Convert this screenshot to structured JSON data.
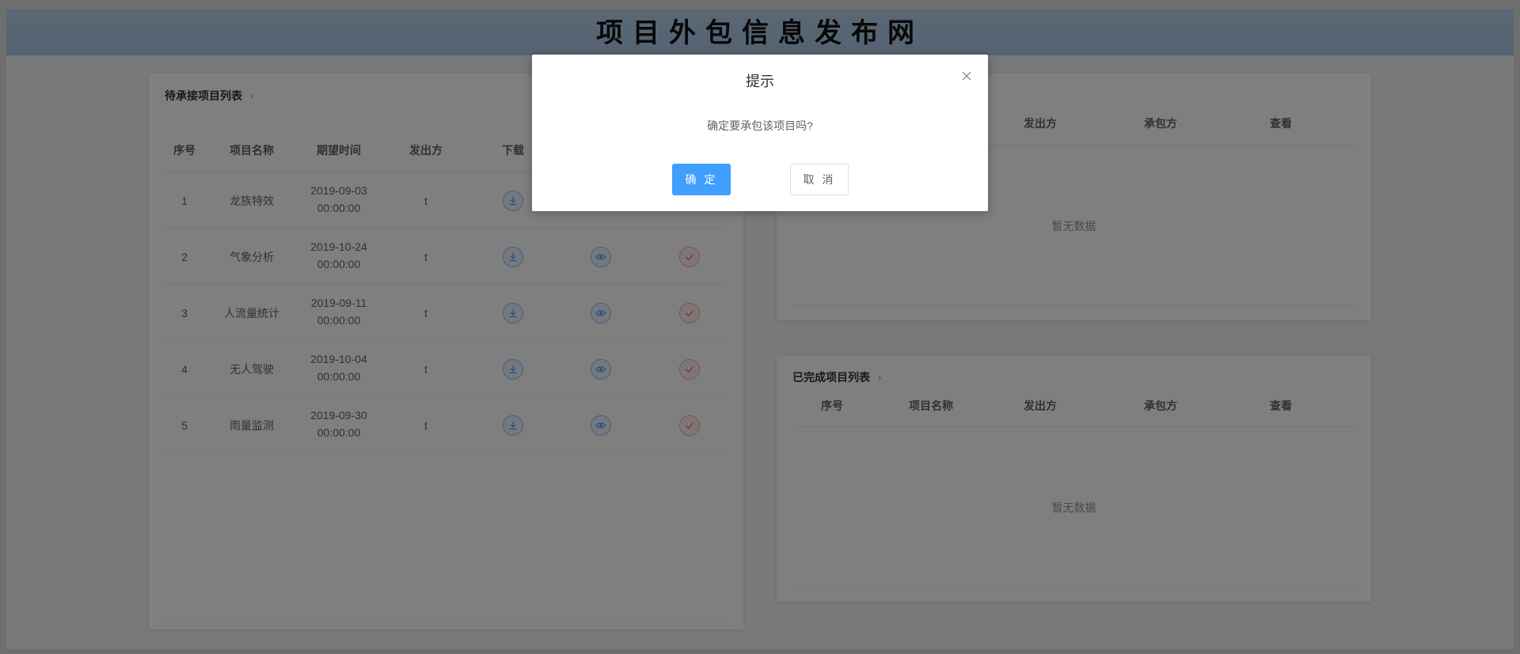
{
  "header": {
    "title": "项目外包信息发布网"
  },
  "pending": {
    "title": "待承接项目列表",
    "chevron": "›",
    "columns": [
      "序号",
      "项目名称",
      "期望时间",
      "发出方",
      "下载"
    ],
    "rows": [
      {
        "no": "1",
        "name": "龙族特效",
        "date": "2019-09-03",
        "time": "00:00:00",
        "from": "t"
      },
      {
        "no": "2",
        "name": "气象分析",
        "date": "2019-10-24",
        "time": "00:00:00",
        "from": "t"
      },
      {
        "no": "3",
        "name": "人流量统计",
        "date": "2019-09-11",
        "time": "00:00:00",
        "from": "t"
      },
      {
        "no": "4",
        "name": "无人驾驶",
        "date": "2019-10-04",
        "time": "00:00:00",
        "from": "t"
      },
      {
        "no": "5",
        "name": "雨量监测",
        "date": "2019-09-30",
        "time": "00:00:00",
        "from": "t"
      }
    ]
  },
  "in_progress": {
    "columns": [
      "发出方",
      "承包方",
      "查看"
    ],
    "empty_text": "暂无数据"
  },
  "completed": {
    "title": "已完成项目列表",
    "chevron": "›",
    "columns": [
      "序号",
      "项目名称",
      "发出方",
      "承包方",
      "查看"
    ],
    "empty_text": "暂无数据"
  },
  "dialog": {
    "title": "提示",
    "message": "确定要承包该项目吗?",
    "confirm_label": "确 定",
    "cancel_label": "取 消"
  },
  "icons": {
    "download": "download-icon",
    "view": "eye-icon",
    "accept": "check-icon",
    "close": "close-icon"
  },
  "colors": {
    "primary": "#409eff",
    "header_bg": "#b5cfe8",
    "danger": "#f56c6c"
  }
}
